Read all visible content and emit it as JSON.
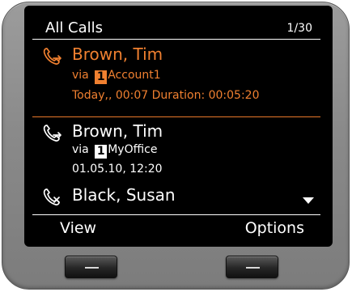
{
  "header": {
    "title": "All Calls",
    "counter": "1/30"
  },
  "entries": [
    {
      "icon": "call-forwarded-icon",
      "name": "Brown, Tim",
      "via_prefix": "via",
      "account_number": "1",
      "account_name": "Account1",
      "date_line": "Today,, 00:07  Duration: 00:05:20",
      "selected": true,
      "color": "#f08030"
    },
    {
      "icon": "call-forwarded-icon",
      "name": "Brown, Tim",
      "via_prefix": "via",
      "account_number": "1",
      "account_name": "MyOffice",
      "date_line": "01.05.10, 12:20",
      "selected": false,
      "color": "#ffffff"
    },
    {
      "icon": "missed-call-icon",
      "name": "Black, Susan",
      "selected": false,
      "color": "#ffffff"
    }
  ],
  "softkeys": {
    "left": "View",
    "right": "Options"
  },
  "colors": {
    "highlight": "#f08030",
    "screen_bg": "#000000",
    "device_body": "#8a8a8a"
  }
}
